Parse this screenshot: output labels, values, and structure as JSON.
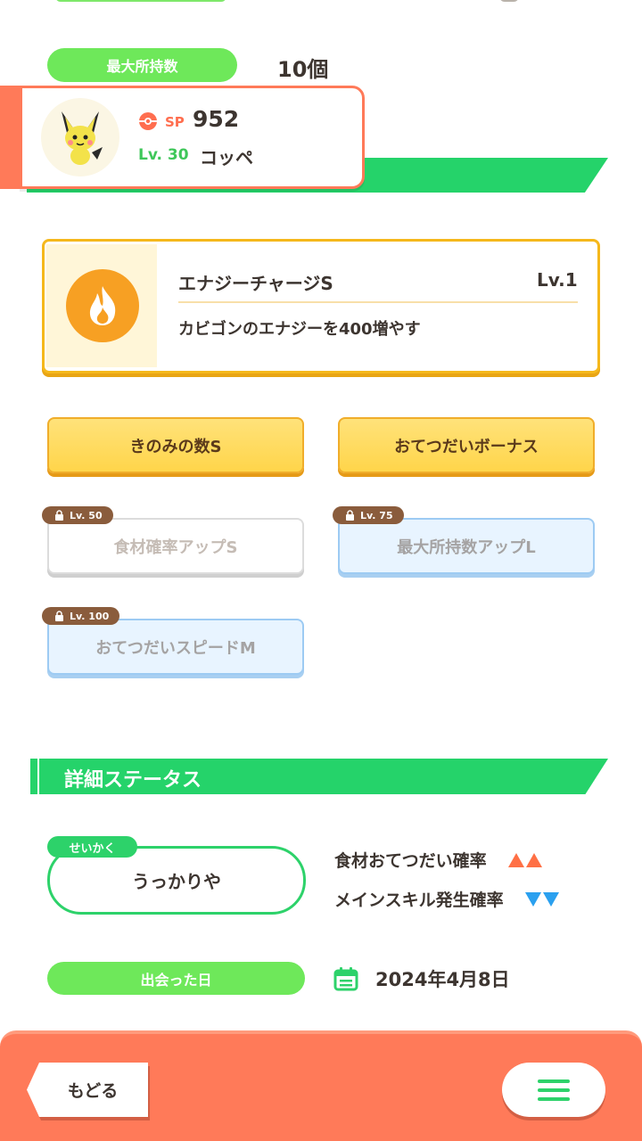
{
  "inventory": {
    "max_label": "最大所持数",
    "max_value": "10個"
  },
  "pokemon": {
    "sp_label": "SP",
    "sp_value": "952",
    "level": "Lv. 30",
    "name": "コッペ"
  },
  "main_skill": {
    "name": "エナジーチャージS",
    "level": "Lv.1",
    "description": "カビゴンのエナジーを400増やす"
  },
  "sub_skills": [
    {
      "label": "きのみの数S",
      "lock": ""
    },
    {
      "label": "おてつだいボーナス",
      "lock": ""
    },
    {
      "label": "食材確率アップS",
      "lock": "Lv. 50"
    },
    {
      "label": "最大所持数アップL",
      "lock": "Lv. 75"
    },
    {
      "label": "おてつだいスピードM",
      "lock": "Lv. 100"
    }
  ],
  "details": {
    "title": "詳細ステータス",
    "nature_tag": "せいかく",
    "nature": "うっかりや",
    "up_stat": "食材おてつだい確率",
    "down_stat": "メインスキル発生確率",
    "met_label": "出会った日",
    "met_date": "2024年4月8日"
  },
  "footer": {
    "back_label": "もどる"
  },
  "colors": {
    "green": "#25d36a",
    "coral": "#ff7a59",
    "gold": "#f5b81c",
    "up": "#ff7045",
    "down": "#2aa0ef"
  },
  "icons": {
    "sp": "pokeball-icon",
    "skill": "flame-icon",
    "calendar": "calendar-icon",
    "menu": "hamburger-icon",
    "lock": "lock-icon"
  }
}
